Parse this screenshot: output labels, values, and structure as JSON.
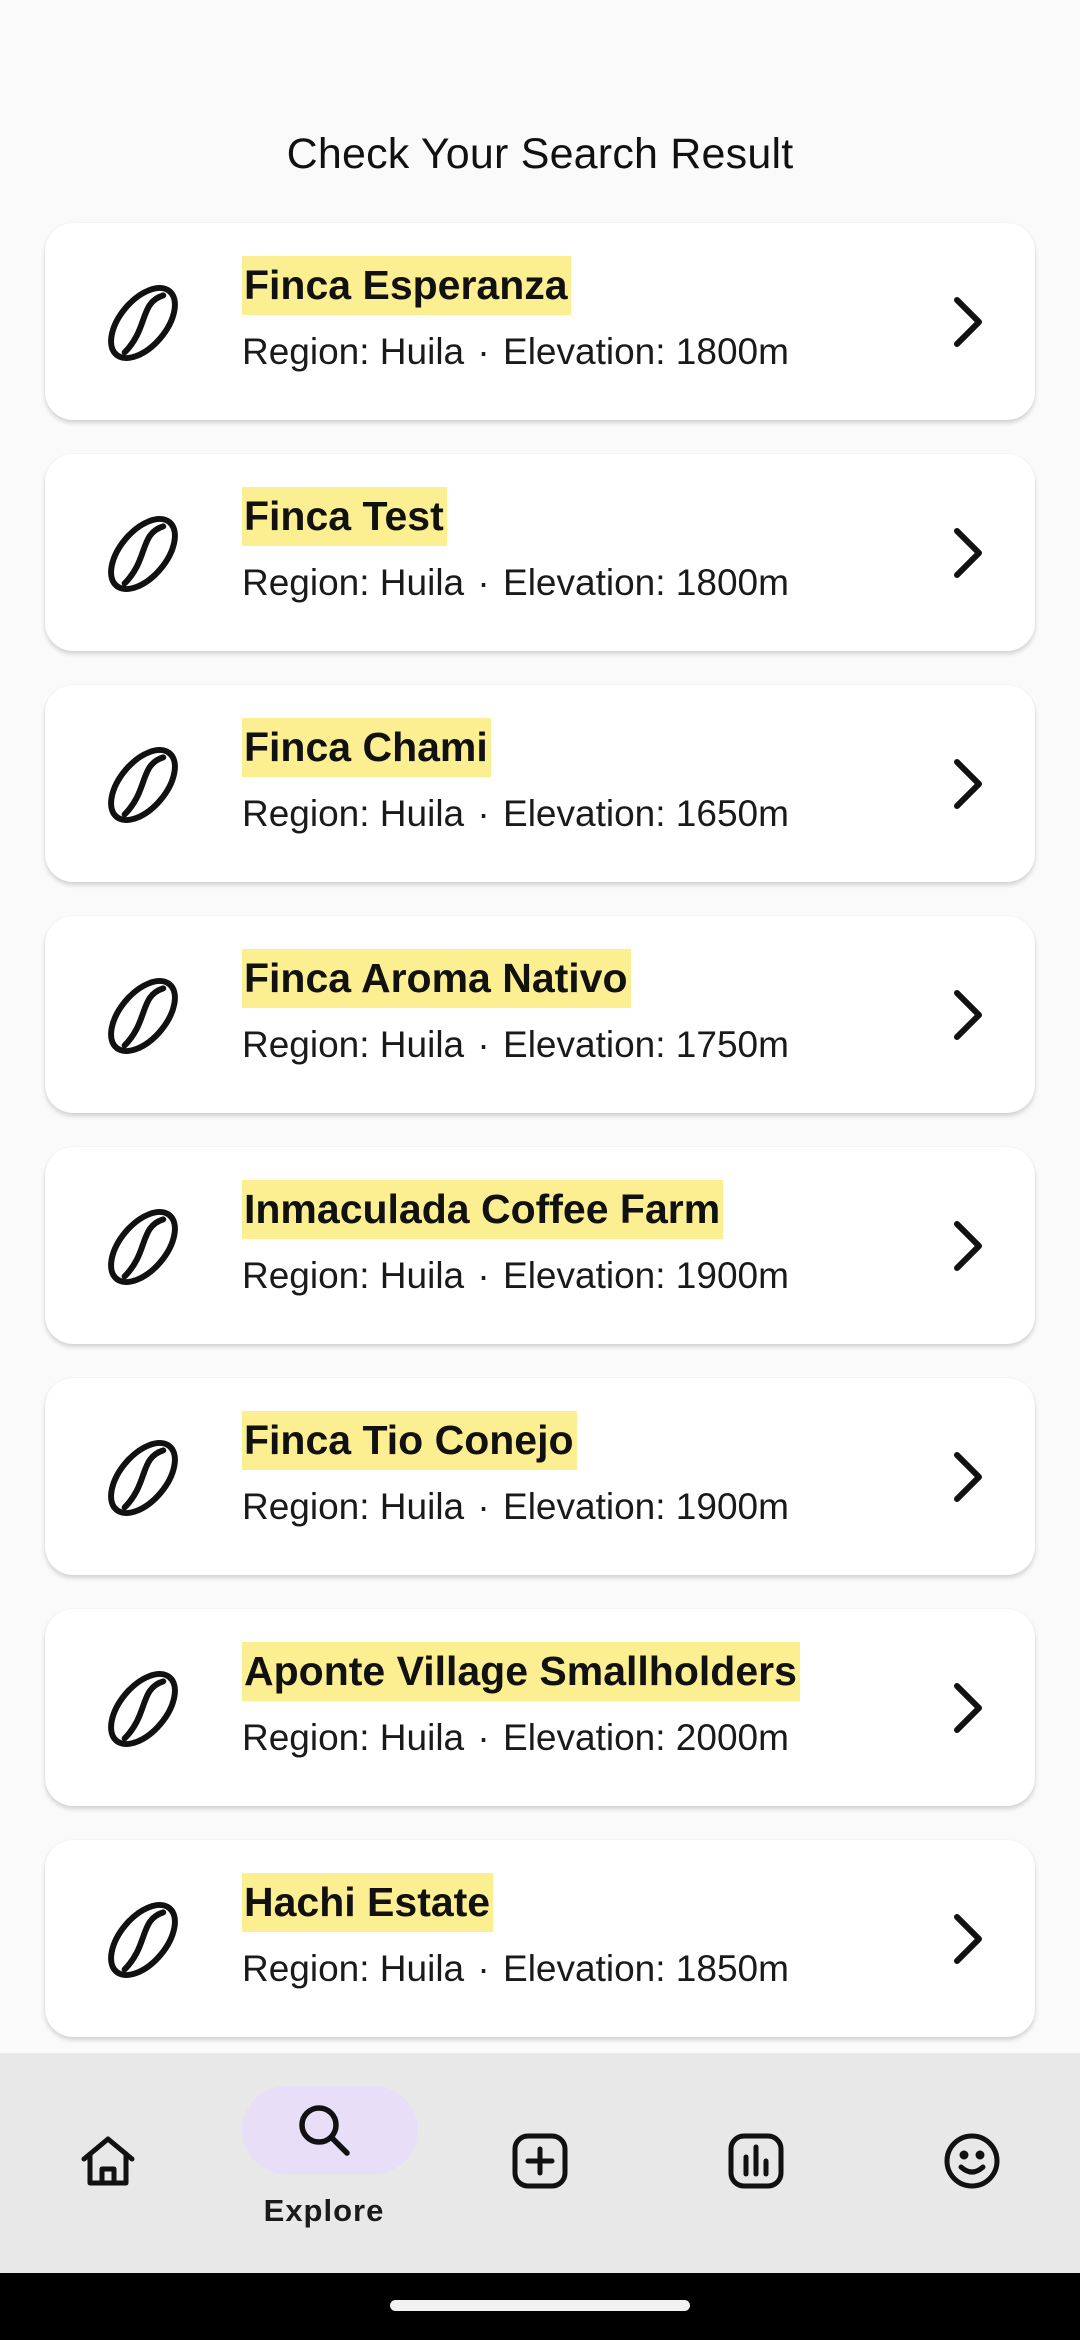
{
  "colors": {
    "highlight": "#FCEF91",
    "nav_background": "#E8E8E8",
    "active_pill": "#E8DEF8",
    "card_background": "#FFFFFF"
  },
  "header": {
    "title": "Check Your Search Result"
  },
  "results": [
    {
      "name": "Finca Esperanza",
      "region": "Region: Huila",
      "separator": "·",
      "elevation": "Elevation: 1800m",
      "icon": "coffee-bean-icon"
    },
    {
      "name": "Finca Test",
      "region": "Region: Huila",
      "separator": "·",
      "elevation": "Elevation: 1800m",
      "icon": "coffee-bean-icon"
    },
    {
      "name": "Finca Chami",
      "region": "Region: Huila",
      "separator": "·",
      "elevation": "Elevation: 1650m",
      "icon": "coffee-bean-icon"
    },
    {
      "name": "Finca Aroma Nativo",
      "region": "Region: Huila",
      "separator": "·",
      "elevation": "Elevation: 1750m",
      "icon": "coffee-bean-icon"
    },
    {
      "name": "Inmaculada Coffee Farm",
      "region": "Region: Huila",
      "separator": "·",
      "elevation": "Elevation: 1900m",
      "icon": "coffee-bean-icon"
    },
    {
      "name": "Finca Tio Conejo",
      "region": "Region: Huila",
      "separator": "·",
      "elevation": "Elevation: 1900m",
      "icon": "coffee-bean-icon"
    },
    {
      "name": "Aponte Village Smallholders",
      "region": "Region: Huila",
      "separator": "·",
      "elevation": "Elevation: 2000m",
      "icon": "coffee-bean-icon"
    },
    {
      "name": "Hachi Estate",
      "region": "Region: Huila",
      "separator": "·",
      "elevation": "Elevation: 1850m",
      "icon": "coffee-bean-icon"
    }
  ],
  "bottom_nav": {
    "active": "explore",
    "items": [
      {
        "id": "home",
        "icon": "home-icon",
        "label": ""
      },
      {
        "id": "explore",
        "icon": "search-icon",
        "label": "Explore"
      },
      {
        "id": "add",
        "icon": "add-box-icon",
        "label": ""
      },
      {
        "id": "stats",
        "icon": "bar-chart-icon",
        "label": ""
      },
      {
        "id": "profile",
        "icon": "smiley-face-icon",
        "label": ""
      }
    ]
  }
}
